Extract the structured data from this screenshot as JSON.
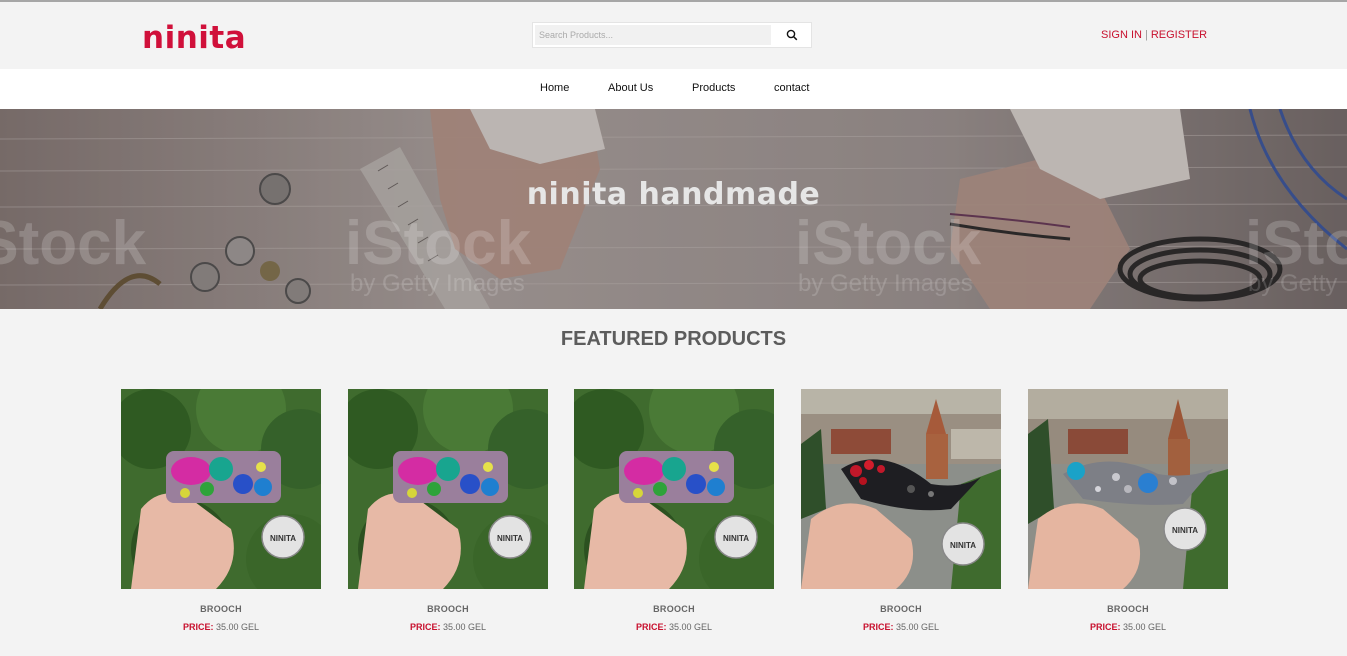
{
  "brand": {
    "logo_text": "ninita",
    "accent_color": "#c8102e"
  },
  "search": {
    "placeholder": "Search Products...",
    "icon": "search-icon"
  },
  "auth": {
    "sign_in": "SIGN IN",
    "separator": "|",
    "register": "REGISTER"
  },
  "nav": {
    "items": [
      "Home",
      "About Us",
      "Products",
      "contact"
    ]
  },
  "hero": {
    "title": "ninita handmade",
    "watermark": "iStock by Getty Images"
  },
  "featured": {
    "title": "FEATURED PRODUCTS",
    "products": [
      {
        "name": "BROOCH",
        "price_label": "PRICE:",
        "price": "35.00 GEL",
        "badge": "NINITA"
      },
      {
        "name": "BROOCH",
        "price_label": "PRICE:",
        "price": "35.00 GEL",
        "badge": "NINITA"
      },
      {
        "name": "BROOCH",
        "price_label": "PRICE:",
        "price": "35.00 GEL",
        "badge": "NINITA"
      },
      {
        "name": "BROOCH",
        "price_label": "PRICE:",
        "price": "35.00 GEL",
        "badge": "NINITA"
      },
      {
        "name": "BROOCH",
        "price_label": "PRICE:",
        "price": "35.00 GEL",
        "badge": "NINITA"
      }
    ]
  }
}
